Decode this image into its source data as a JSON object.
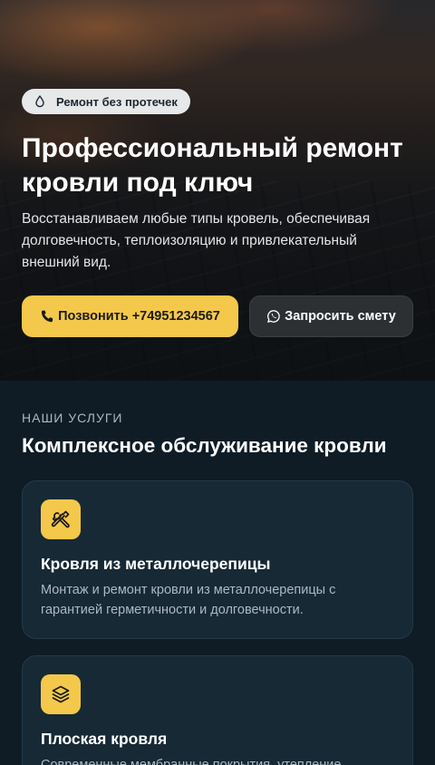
{
  "hero": {
    "badge": {
      "icon": "drop-icon",
      "label": "Ремонт без протечек"
    },
    "title": "Профессиональный ремонт кровли под ключ",
    "subtitle": "Восстанавливаем любые типы кровель, обеспечивая долговечность, теплоизоляцию и привлекательный внешний вид.",
    "buttons": {
      "call": {
        "icon": "phone-icon",
        "label": "Позвонить +74951234567"
      },
      "quote": {
        "icon": "whatsapp-icon",
        "label": "Запросить смету"
      }
    }
  },
  "services": {
    "eyebrow": "НАШИ УСЛУГИ",
    "title": "Комплексное обслуживание кровли",
    "items": [
      {
        "icon": "tools-icon",
        "title": "Кровля из металлочерепицы",
        "text": "Монтаж и ремонт кровли из металлочерепицы с гарантией герметичности и долговечности."
      },
      {
        "icon": "layers-icon",
        "title": "Плоская кровля",
        "text": "Современные мембранные покрытия, утепление"
      }
    ]
  },
  "colors": {
    "accent": "#f4c84a",
    "background": "#0f1c25",
    "card": "#162935"
  }
}
